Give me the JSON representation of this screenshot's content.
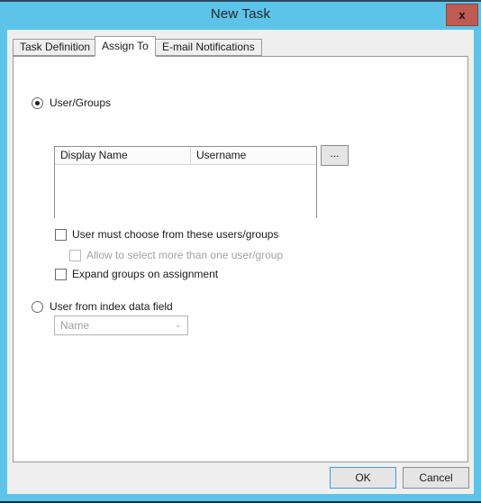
{
  "window": {
    "title": "New Task",
    "close_label": "x",
    "titlebar_color": "#5cc4e8",
    "close_color": "#bf5b52",
    "body_color": "#efefef"
  },
  "tabs": [
    {
      "label": "Task Definition",
      "active": false
    },
    {
      "label": "Assign To",
      "active": true
    },
    {
      "label": "E-mail Notifications",
      "active": false
    }
  ],
  "assign_to": {
    "user_groups": {
      "radio_label": "User/Groups",
      "selected": true,
      "list": {
        "columns": [
          "Display Name",
          "Username"
        ],
        "rows": []
      },
      "browse_label": "...",
      "checkboxes": [
        {
          "label": "User must choose from these users/groups",
          "checked": false,
          "disabled": false
        },
        {
          "label": "Allow to select more than one user/group",
          "checked": false,
          "disabled": true
        },
        {
          "label": "Expand groups on assignment",
          "checked": false,
          "disabled": false
        }
      ]
    },
    "index_field": {
      "radio_label": "User from index data field",
      "selected": false,
      "combo": {
        "value": "Name",
        "arrow": "⌄",
        "disabled": true
      }
    }
  },
  "footer": {
    "ok_label": "OK",
    "cancel_label": "Cancel",
    "focus_color": "#4a9ad4"
  }
}
